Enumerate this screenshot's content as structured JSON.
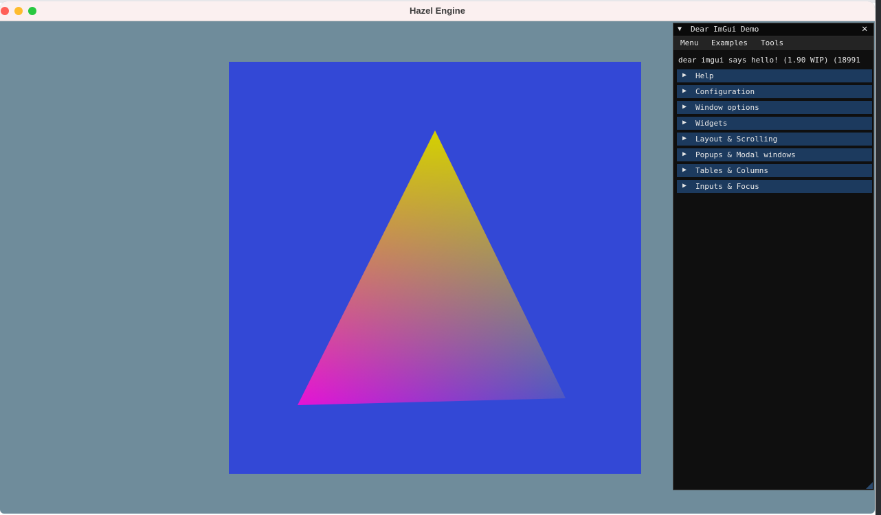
{
  "window": {
    "title": "Hazel Engine"
  },
  "viewport": {
    "background": "#3348d6",
    "triangle_colors": {
      "top": "#d4d100",
      "bottom_left": "#e612d6",
      "bottom_right": "#4a55c8"
    }
  },
  "imgui_demo": {
    "collapse_glyph": "▼",
    "title": "Dear ImGui Demo",
    "close_glyph": "✕",
    "menu": [
      "Menu",
      "Examples",
      "Tools"
    ],
    "hello_text": "dear imgui says hello! (1.90 WIP) (18991",
    "section_arrow": "▶",
    "sections": [
      "Help",
      "Configuration",
      "Window options",
      "Widgets",
      "Layout & Scrolling",
      "Popups & Modal windows",
      "Tables & Columns",
      "Inputs & Focus"
    ],
    "colors": {
      "header_bg": "#1c3a5e",
      "window_bg": "#0f0f0f"
    }
  }
}
